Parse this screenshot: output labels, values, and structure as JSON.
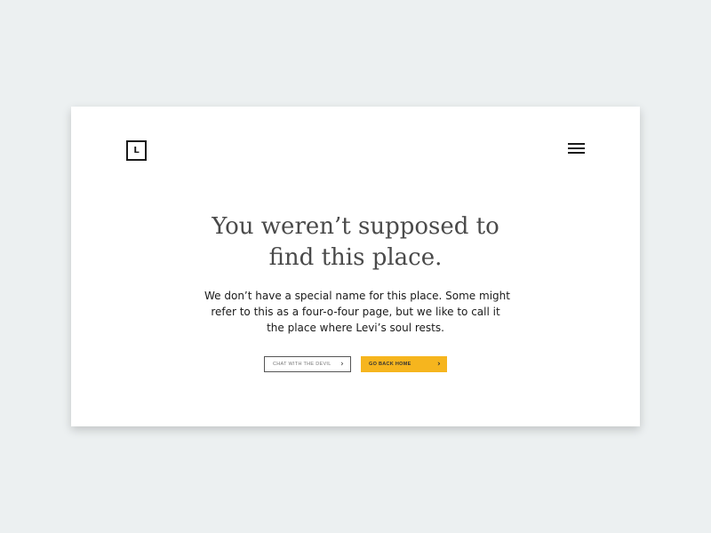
{
  "header": {
    "logo_letter": "L",
    "logo_icon": "square-L-logo",
    "menu_icon": "hamburger-menu-icon"
  },
  "main": {
    "title_lines": [
      "You weren’t supposed to",
      "find this place."
    ],
    "body_lines": [
      "We don’t have a special name for this place. Some might",
      "refer to this as a four-o-four page, but we like to call it",
      "the place where Levi’s soul rests."
    ]
  },
  "actions": {
    "chat_label": "CHAT WITH THE DEVIL",
    "home_label": "GO BACK HOME",
    "chevron_icon": "chevron-right-icon"
  },
  "colors": {
    "background": "#ecf0f1",
    "card": "#ffffff",
    "accent": "#f6b51e",
    "text": "#1a1a1a",
    "title": "#4a4a4a"
  }
}
